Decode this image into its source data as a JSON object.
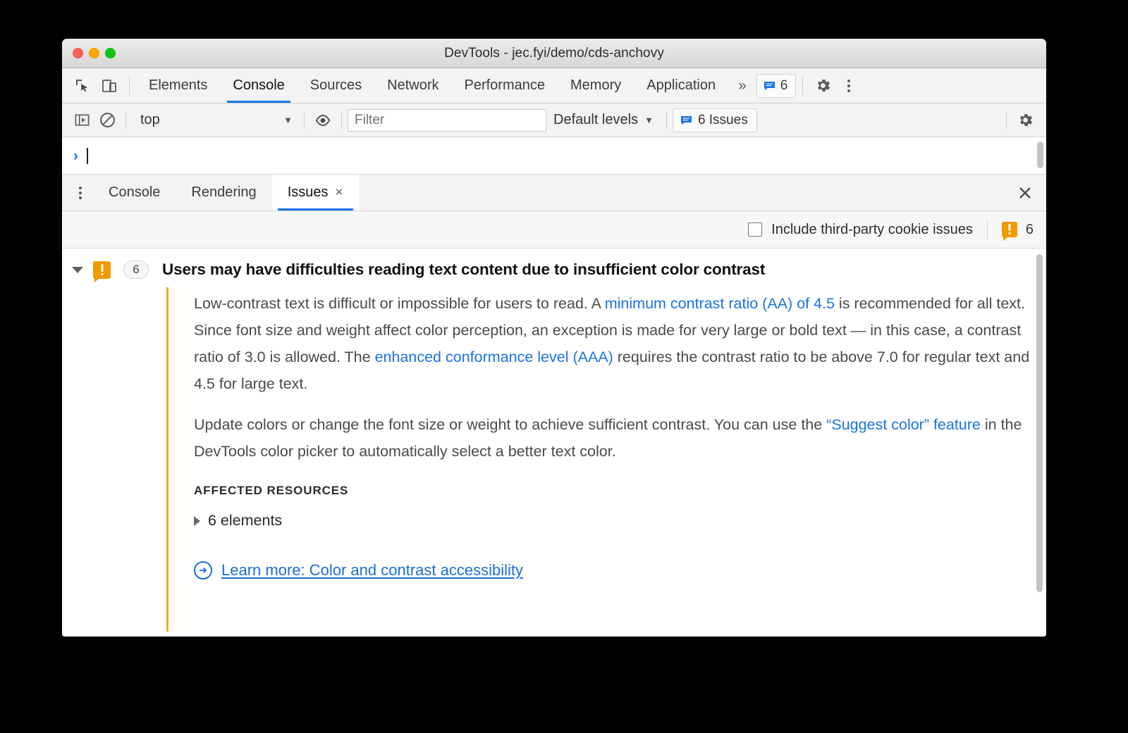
{
  "window": {
    "title": "DevTools - jec.fyi/demo/cds-anchovy",
    "traffic_lights": [
      "close",
      "minimize",
      "maximize"
    ]
  },
  "main_toolbar": {
    "inspect_icon": "inspect-element-icon",
    "device_icon": "device-toolbar-icon",
    "tabs": [
      {
        "label": "Elements",
        "active": false
      },
      {
        "label": "Console",
        "active": true
      },
      {
        "label": "Sources",
        "active": false
      },
      {
        "label": "Network",
        "active": false
      },
      {
        "label": "Performance",
        "active": false
      },
      {
        "label": "Memory",
        "active": false
      },
      {
        "label": "Application",
        "active": false
      }
    ],
    "more_tabs": "»",
    "issues_chip_count": "6",
    "settings_icon": "gear-icon",
    "more_options_icon": "kebab-menu-icon"
  },
  "console_toolbar": {
    "sidebar_toggle_icon": "console-sidebar-icon",
    "clear_icon": "clear-console-icon",
    "context_value": "top",
    "context_caret": "▼",
    "eye_icon": "live-expression-icon",
    "filter_placeholder": "Filter",
    "filter_value": "",
    "levels_label": "Default levels",
    "levels_caret": "▼",
    "issues_button_label": "6 Issues",
    "settings_icon": "gear-icon"
  },
  "console": {
    "prompt_symbol": "›",
    "input_value": ""
  },
  "drawer": {
    "menu_icon": "drawer-menu-icon",
    "tabs": [
      {
        "label": "Console",
        "active": false,
        "closable": false
      },
      {
        "label": "Rendering",
        "active": false,
        "closable": false
      },
      {
        "label": "Issues",
        "active": true,
        "closable": true
      }
    ],
    "tab_close_glyph": "×",
    "close_drawer_glyph": "✕"
  },
  "issues_toolbar": {
    "checkbox_label": "Include third-party cookie issues",
    "checkbox_checked": false,
    "warning_count": "6",
    "warning_icon": "warning-issue-icon"
  },
  "issue": {
    "expanded": true,
    "icon": "warning-issue-icon",
    "count": "6",
    "title": "Users may have difficulties reading text content due to insufficient color contrast",
    "paragraph1": {
      "part1": "Low-contrast text is difficult or impossible for users to read. A ",
      "link1": "minimum contrast ratio (AA) of 4.5",
      "part2": " is recommended for all text. Since font size and weight affect color perception, an exception is made for very large or bold text — in this case, a contrast ratio of 3.0 is allowed. The ",
      "link2": "enhanced conformance level (AAA)",
      "part3": " requires the contrast ratio to be above 7.0 for regular text and 4.5 for large text."
    },
    "paragraph2": {
      "part1": "Update colors or change the font size or weight to achieve sufficient contrast. You can use the ",
      "link1": "“Suggest color” feature",
      "part2": " in the DevTools color picker to automatically select a better text color."
    },
    "affected_resources_heading": "AFFECTED RESOURCES",
    "affected_resource_label": "6 elements",
    "learn_more_label": "Learn more: Color and contrast accessibility",
    "learn_more_icon": "arrow-circle-icon"
  },
  "colors": {
    "accent_blue": "#1a73e8",
    "link_blue": "#1a6fd4",
    "warning_orange": "#f29900",
    "issue_bar_orange": "#f5a623"
  }
}
